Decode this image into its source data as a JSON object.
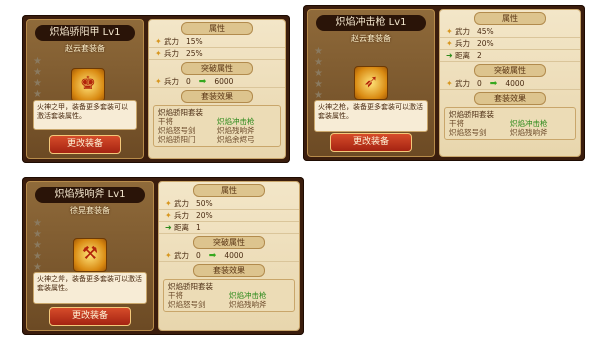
{
  "colors": {
    "frame": "#3b1d0d",
    "accent_green": "#2c8a1b",
    "button": "#b5301a"
  },
  "cards": [
    {
      "title": "炽焰骄阳甲 Lv1",
      "subtitle": "赵云套装备",
      "icon": "armor-icon",
      "description": "火神之甲，装备更多套装可以激活套装属性。",
      "button": "更改装备",
      "attr_header": "属性",
      "attrs": [
        {
          "icon": "sword-icon",
          "label": "武力",
          "value": "15%"
        },
        {
          "icon": "soldier-icon",
          "label": "兵力",
          "value": "25%"
        }
      ],
      "break_header": "突破属性",
      "break_row": {
        "label": "兵力",
        "from": "0",
        "to": "6000"
      },
      "set_header": "套装效果",
      "set_name": "炽焰骄阳套装",
      "set_col_left": [
        "干将",
        "炽焰怒号剑",
        "炽焰骄阳门"
      ],
      "set_col_right": [
        "炽焰冲击枪",
        "炽焰残响斧",
        "炽焰余烬弓"
      ]
    },
    {
      "title": "炽焰冲击枪 Lv1",
      "subtitle": "赵云套装备",
      "icon": "spear-icon",
      "description": "火神之枪，装备更多套装可以激活套装属性。",
      "button": "更改装备",
      "attr_header": "属性",
      "attrs": [
        {
          "icon": "sword-icon",
          "label": "武力",
          "value": "45%"
        },
        {
          "icon": "soldier-icon",
          "label": "兵力",
          "value": "20%"
        },
        {
          "icon": "range-icon",
          "label": "距离",
          "value": "2"
        }
      ],
      "break_header": "突破属性",
      "break_row": {
        "label": "武力",
        "from": "0",
        "to": "4000"
      },
      "set_header": "套装效果",
      "set_name": "炽焰骄阳套装",
      "set_col_left": [
        "干将",
        "炽焰怒号剑"
      ],
      "set_col_right": [
        "炽焰冲击枪",
        "炽焰残响斧"
      ]
    },
    {
      "title": "炽焰残响斧 Lv1",
      "subtitle": "徐晃套装备",
      "icon": "axe-icon",
      "description": "火神之斧，装备更多套装可以激活套装属性。",
      "button": "更改装备",
      "attr_header": "属性",
      "attrs": [
        {
          "icon": "sword-icon",
          "label": "武力",
          "value": "50%"
        },
        {
          "icon": "soldier-icon",
          "label": "兵力",
          "value": "20%"
        },
        {
          "icon": "range-icon",
          "label": "距离",
          "value": "1"
        }
      ],
      "break_header": "突破属性",
      "break_row": {
        "label": "武力",
        "from": "0",
        "to": "4000"
      },
      "set_header": "套装效果",
      "set_name": "炽焰骄阳套装",
      "set_col_left": [
        "干将",
        "炽焰怒号剑"
      ],
      "set_col_right": [
        "炽焰冲击枪",
        "炽焰残响斧"
      ]
    }
  ]
}
